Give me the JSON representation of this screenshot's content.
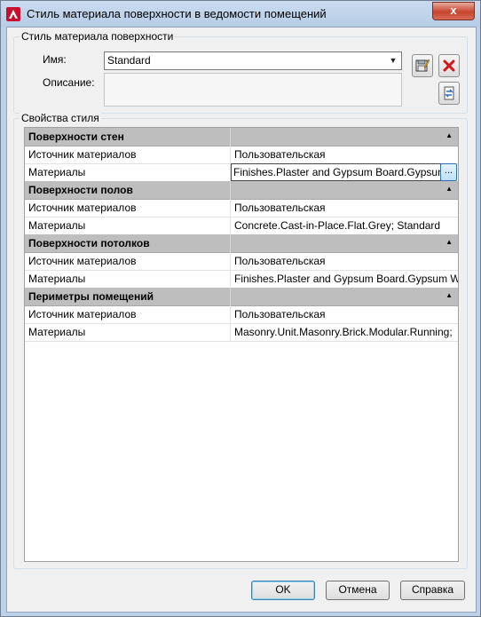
{
  "window": {
    "title": "Стиль материала поверхности в ведомости помещений",
    "close_label": "x"
  },
  "surface_group": {
    "label": "Стиль материала поверхности",
    "name_label": "Имя:",
    "name_value": "Standard",
    "description_label": "Описание:",
    "description_value": ""
  },
  "properties": {
    "label": "Свойства стиля",
    "categories": [
      {
        "title": "Поверхности стен",
        "rows": [
          {
            "name": "Источник материалов",
            "value": "Пользовательская"
          },
          {
            "name": "Материалы",
            "value": "Finishes.Plaster and Gypsum Board.Gypsum"
          }
        ]
      },
      {
        "title": "Поверхности полов",
        "rows": [
          {
            "name": "Источник материалов",
            "value": "Пользовательская"
          },
          {
            "name": "Материалы",
            "value": "Concrete.Cast-in-Place.Flat.Grey; Standard"
          }
        ]
      },
      {
        "title": "Поверхности потолков",
        "rows": [
          {
            "name": "Источник материалов",
            "value": "Пользовательская"
          },
          {
            "name": "Материалы",
            "value": "Finishes.Plaster and Gypsum Board.Gypsum Wa"
          }
        ]
      },
      {
        "title": "Периметры помещений",
        "rows": [
          {
            "name": "Источник материалов",
            "value": "Пользовательская"
          },
          {
            "name": "Материалы",
            "value": "Masonry.Unit.Masonry.Brick.Modular.Running;"
          }
        ]
      }
    ],
    "ellipsis": "..."
  },
  "buttons": {
    "ok": "OK",
    "cancel": "Отмена",
    "help": "Справка"
  },
  "colors": {
    "accent": "#c7462f",
    "category_bg": "#bebebe",
    "title_bar": "#bcd0e7"
  }
}
